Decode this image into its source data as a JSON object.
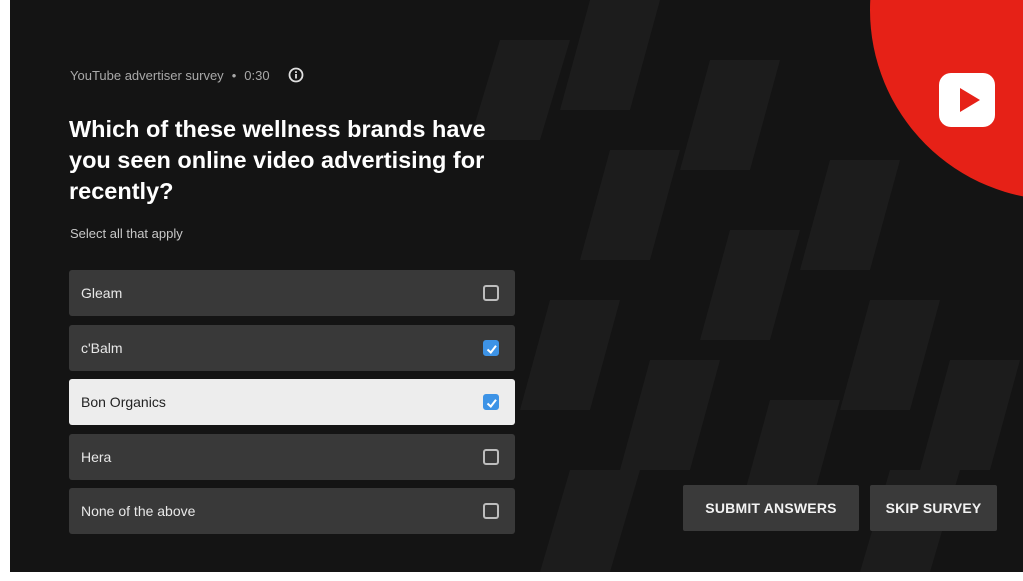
{
  "survey": {
    "source": "YouTube advertiser survey",
    "separator": "•",
    "time": "0:30",
    "question": "Which of these wellness brands have you seen online video advertising for recently?",
    "instruction": "Select all that apply"
  },
  "options": [
    {
      "label": "Gleam",
      "checked": false,
      "focused": false
    },
    {
      "label": "c'Balm",
      "checked": true,
      "focused": false
    },
    {
      "label": "Bon Organics",
      "checked": true,
      "focused": true
    },
    {
      "label": "Hera",
      "checked": false,
      "focused": false
    },
    {
      "label": "None of the above",
      "checked": false,
      "focused": false
    }
  ],
  "buttons": {
    "submit": "SUBMIT ANSWERS",
    "skip": "SKIP SURVEY"
  },
  "colors": {
    "background": "#141414",
    "brand_red": "#e62117",
    "checkbox_checked": "#3d93e6"
  },
  "icons": {
    "info": "info-icon",
    "logo": "youtube-logo-icon",
    "check": "checkmark-icon"
  }
}
